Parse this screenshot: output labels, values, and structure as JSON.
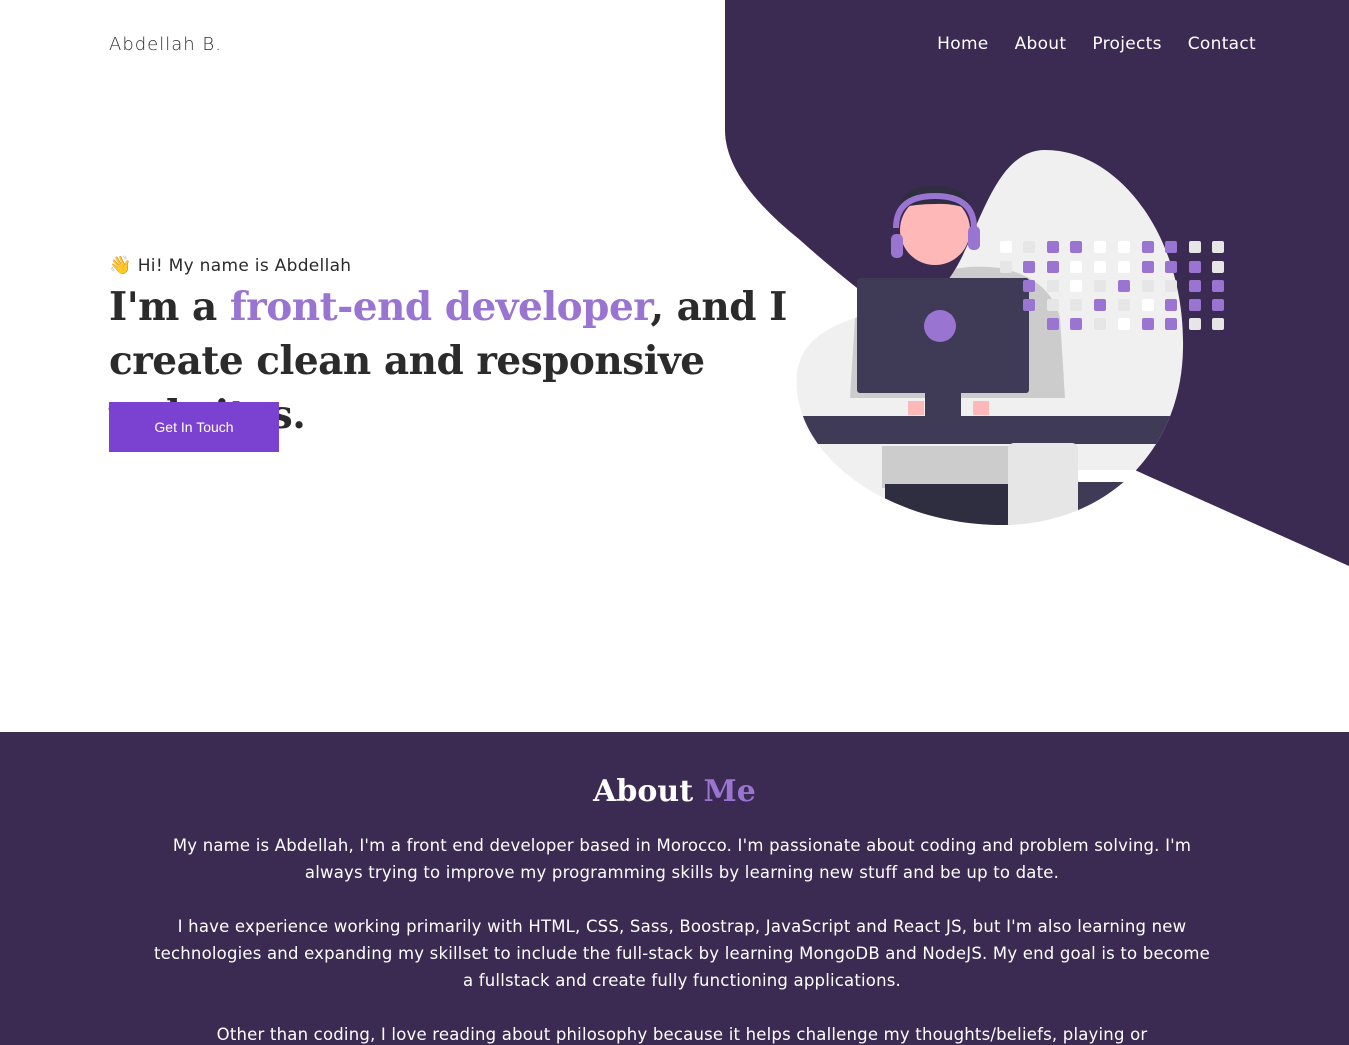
{
  "brand": {
    "logo_text": "Abdellah B."
  },
  "nav": {
    "items": [
      "Home",
      "About",
      "Projects",
      "Contact"
    ]
  },
  "hero": {
    "greeting_icon": "waving-hand-icon",
    "greeting_emoji": "👋",
    "greeting": "Hi! My name is Abdellah",
    "headline_part1": "I'm a ",
    "headline_accent": "front-end developer",
    "headline_part2": ", and I create clean and responsive websites.",
    "cta_label": "Get In Touch"
  },
  "about": {
    "title_main": "About ",
    "title_accent": "Me",
    "paragraphs": [
      "My name is Abdellah, I'm a front end developer based in Morocco. I'm passionate about coding and problem solving. I'm always trying to improve my programming skills by learning new stuff and be up to date.",
      "I have experience working primarily with HTML, CSS, Sass, Boostrap, JavaScript and React JS, but I'm also learning new technologies and expanding my skillset to include the full-stack by learning MongoDB and NodeJS. My end goal is to become a fullstack and create fully functioning applications.",
      "Other than coding, I love reading about philosophy because it helps challenge my thoughts/beliefs, playing or"
    ]
  },
  "colors": {
    "purple_dark": "#3b2a52",
    "accent": "#9a74d1",
    "button": "#7b42d1",
    "text": "#2b2b2b"
  }
}
